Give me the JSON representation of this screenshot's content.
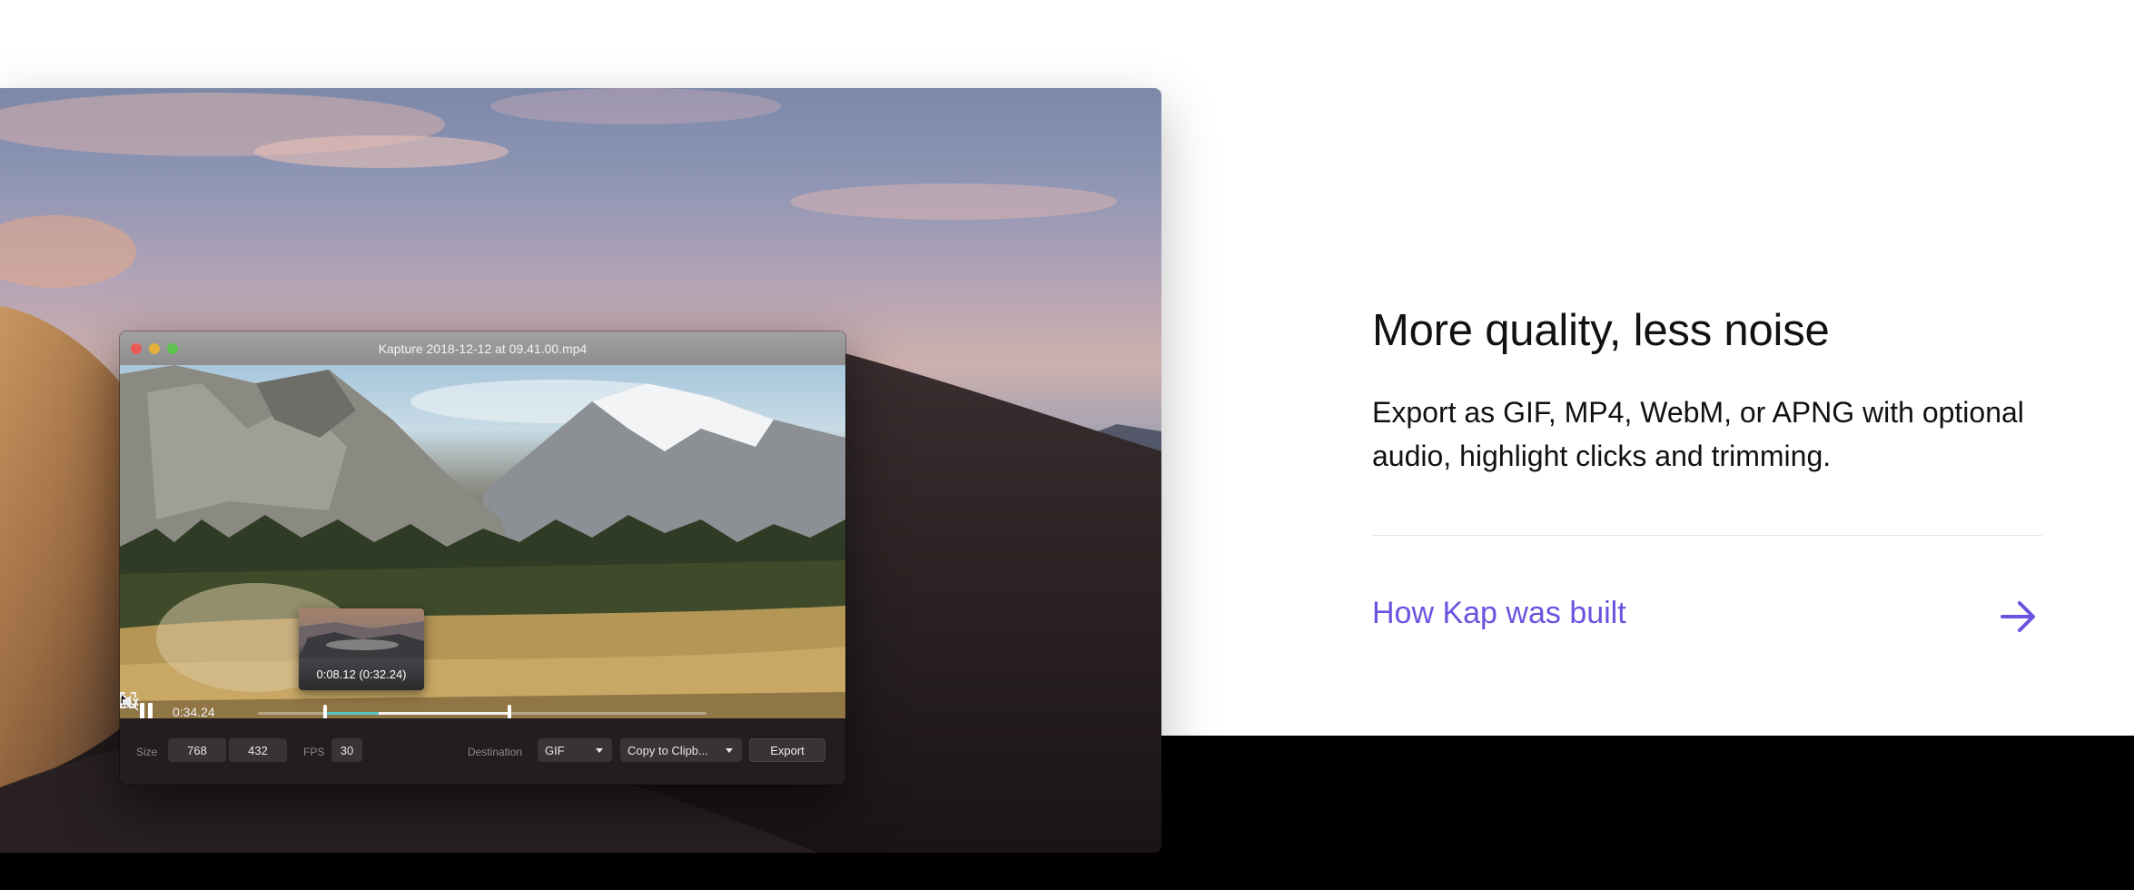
{
  "kap_window": {
    "title": "Kapture 2018-12-12 at 09.41.00.mp4",
    "player": {
      "elapsed": "0:34.24",
      "preview_time": "0:08.12 (0:32.24)",
      "trim_start": 0.15,
      "trim_end": 0.56,
      "progress": 0.27
    },
    "toolbar": {
      "size_label": "Size",
      "width": "768",
      "height": "432",
      "fps_label": "FPS",
      "fps": "30",
      "destination_label": "Destination",
      "format": "GIF",
      "destination": "Copy to Clipb...",
      "export_label": "Export"
    }
  },
  "feature": {
    "title": "More quality, less noise",
    "description": "Export as GIF, MP4, WebM, or APNG with optional audio, highlight clicks and trimming.",
    "link_label": "How Kap was built"
  },
  "colors": {
    "accent": "#6b53e0",
    "playhead": "#5bc2c6",
    "toolbar_bg": "#231d1d"
  },
  "icons": [
    "pause-icon",
    "mute-icon",
    "fullscreen-icon",
    "cursor-icon",
    "arrow-right-icon",
    "caret-down-icon"
  ]
}
